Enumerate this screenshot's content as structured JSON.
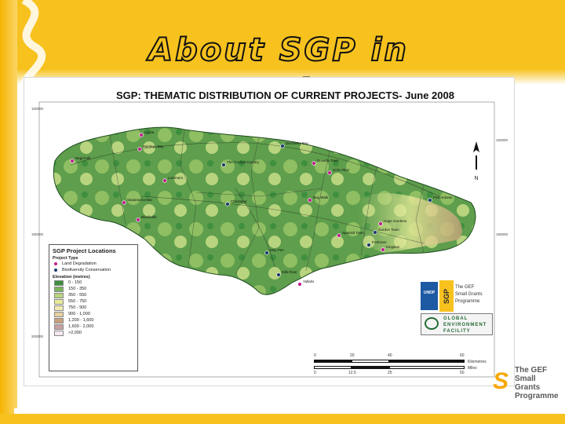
{
  "slide": {
    "title": "About SGP in Jamaica",
    "colors": {
      "brand_yellow": "#f7c21e",
      "brand_orange": "#f5b400"
    }
  },
  "map": {
    "title": "SGP: THEMATIC DISTRIBUTION OF CURRENT PROJECTS- June 2008",
    "legend": {
      "heading": "SGP Project Locations",
      "project_type_heading": "Project Type",
      "project_types": [
        {
          "label": "Land Degradation",
          "color": "#c0208a"
        },
        {
          "label": "Biodiversity Conservation",
          "color": "#1c3a6b"
        }
      ],
      "elevation_heading": "Elevation (metres)",
      "elevation_classes": [
        {
          "label": "0 - 150",
          "color": "#3f8f3f"
        },
        {
          "label": "150 - 350",
          "color": "#7bb35a"
        },
        {
          "label": "350 - 550",
          "color": "#b8d47e"
        },
        {
          "label": "550 - 750",
          "color": "#e8ec9a"
        },
        {
          "label": "750 - 900",
          "color": "#f2eab2"
        },
        {
          "label": "900 - 1,000",
          "color": "#e6cfa1"
        },
        {
          "label": "1,200 - 1,600",
          "color": "#caa07c"
        },
        {
          "label": "1,600 - 2,000",
          "color": "#c7a2a0"
        },
        {
          "label": ">2,000",
          "color": "#f4e8f0"
        }
      ]
    },
    "places": [
      {
        "label": "Lucea",
        "type": "Land Degradation"
      },
      {
        "label": "Montego Bay",
        "type": "Land Degradation"
      },
      {
        "label": "Negril Hill",
        "type": "Land Degradation"
      },
      {
        "label": "The Cockpit Country",
        "type": "Biodiversity Conservation"
      },
      {
        "label": "Lorrimers",
        "type": "Land Degradation"
      },
      {
        "label": "Savanna-la-Mar",
        "type": "Land Degradation"
      },
      {
        "label": "Bluefields",
        "type": "Land Degradation"
      },
      {
        "label": "Discovery Bay",
        "type": "Biodiversity Conservation"
      },
      {
        "label": "Brown's Town",
        "type": "Land Degradation"
      },
      {
        "label": "Ocho Rios",
        "type": "Land Degradation"
      },
      {
        "label": "Christiana",
        "type": "Biodiversity Conservation"
      },
      {
        "label": "Bog Walk",
        "type": "Land Degradation"
      },
      {
        "label": "Port Antonio",
        "type": "Biodiversity Conservation"
      },
      {
        "label": "Hope Gardens",
        "type": "Land Degradation"
      },
      {
        "label": "Gordon Town",
        "type": "Biodiversity Conservation"
      },
      {
        "label": "Spanish Town",
        "type": "Land Degradation"
      },
      {
        "label": "Kingston",
        "type": "Land Degradation"
      },
      {
        "label": "Portmore",
        "type": "Biodiversity Conservation"
      },
      {
        "label": "May Pen",
        "type": "Biodiversity Conservation"
      },
      {
        "label": "Milk River",
        "type": "Biodiversity Conservation"
      },
      {
        "label": "Yallahs",
        "type": "Land Degradation"
      }
    ],
    "logos": {
      "undp": "UNDP",
      "sgp_vertical": "SGP",
      "sgp_text": [
        "The GEF",
        "Small Grants",
        "Programme"
      ],
      "gef_text": [
        "GLOBAL",
        "ENVIRONMENT",
        "FACILITY"
      ]
    },
    "scale": {
      "unit_top": "Kilometres",
      "unit_bottom": "Miles",
      "km_ticks": [
        "0",
        "20",
        "40",
        "60"
      ],
      "mi_ticks": [
        "0",
        "12.5",
        "25",
        "50"
      ]
    },
    "north_arrow": "N"
  },
  "branding": {
    "lines": [
      "The GEF",
      "Small Grants",
      "Programme"
    ]
  }
}
